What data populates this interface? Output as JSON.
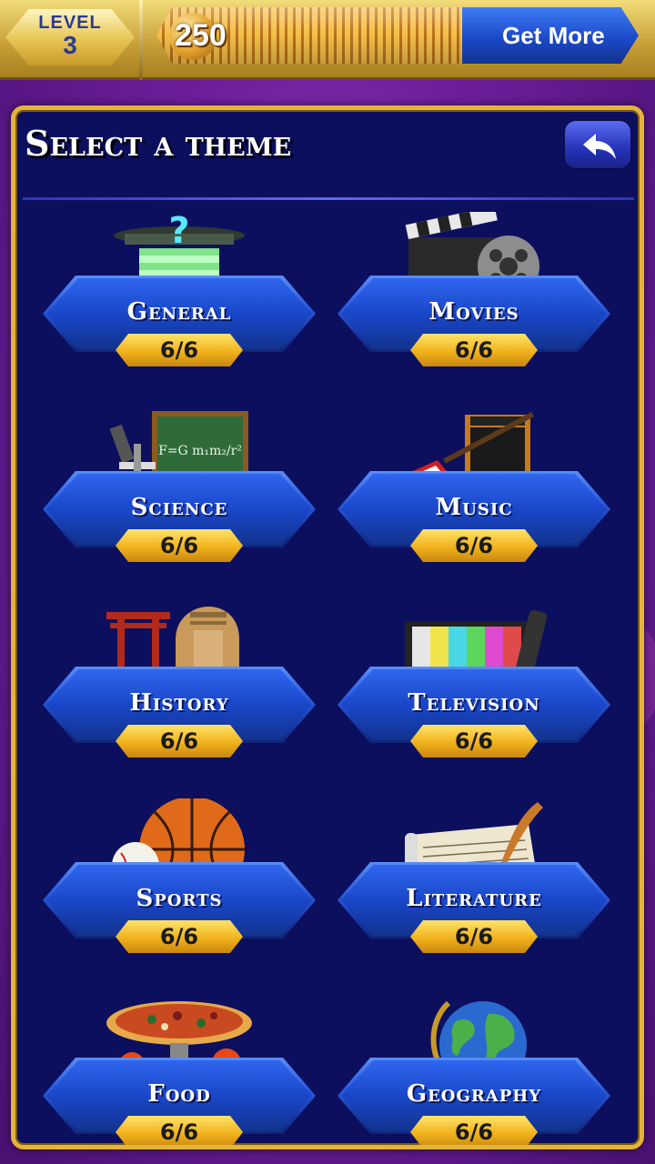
{
  "level": {
    "label": "LEVEL",
    "number": "3"
  },
  "coins": {
    "value": "250"
  },
  "get_more": {
    "label": "Get More"
  },
  "panel": {
    "title": "Select a theme"
  },
  "themes": [
    {
      "name": "General",
      "score": "6/6",
      "icon": "podium-question-icon"
    },
    {
      "name": "Movies",
      "score": "6/6",
      "icon": "film-clapper-reel-icon"
    },
    {
      "name": "Science",
      "score": "6/6",
      "icon": "microscope-chalkboard-icon"
    },
    {
      "name": "Music",
      "score": "6/6",
      "icon": "guitar-amp-icon"
    },
    {
      "name": "History",
      "score": "6/6",
      "icon": "sphinx-torii-icon"
    },
    {
      "name": "Television",
      "score": "6/6",
      "icon": "tv-remote-icon"
    },
    {
      "name": "Sports",
      "score": "6/6",
      "icon": "basketball-baseball-icon"
    },
    {
      "name": "Literature",
      "score": "6/6",
      "icon": "quill-paper-icon"
    },
    {
      "name": "Food",
      "score": "6/6",
      "icon": "pizza-icon"
    },
    {
      "name": "Geography",
      "score": "6/6",
      "icon": "globe-icon"
    }
  ]
}
